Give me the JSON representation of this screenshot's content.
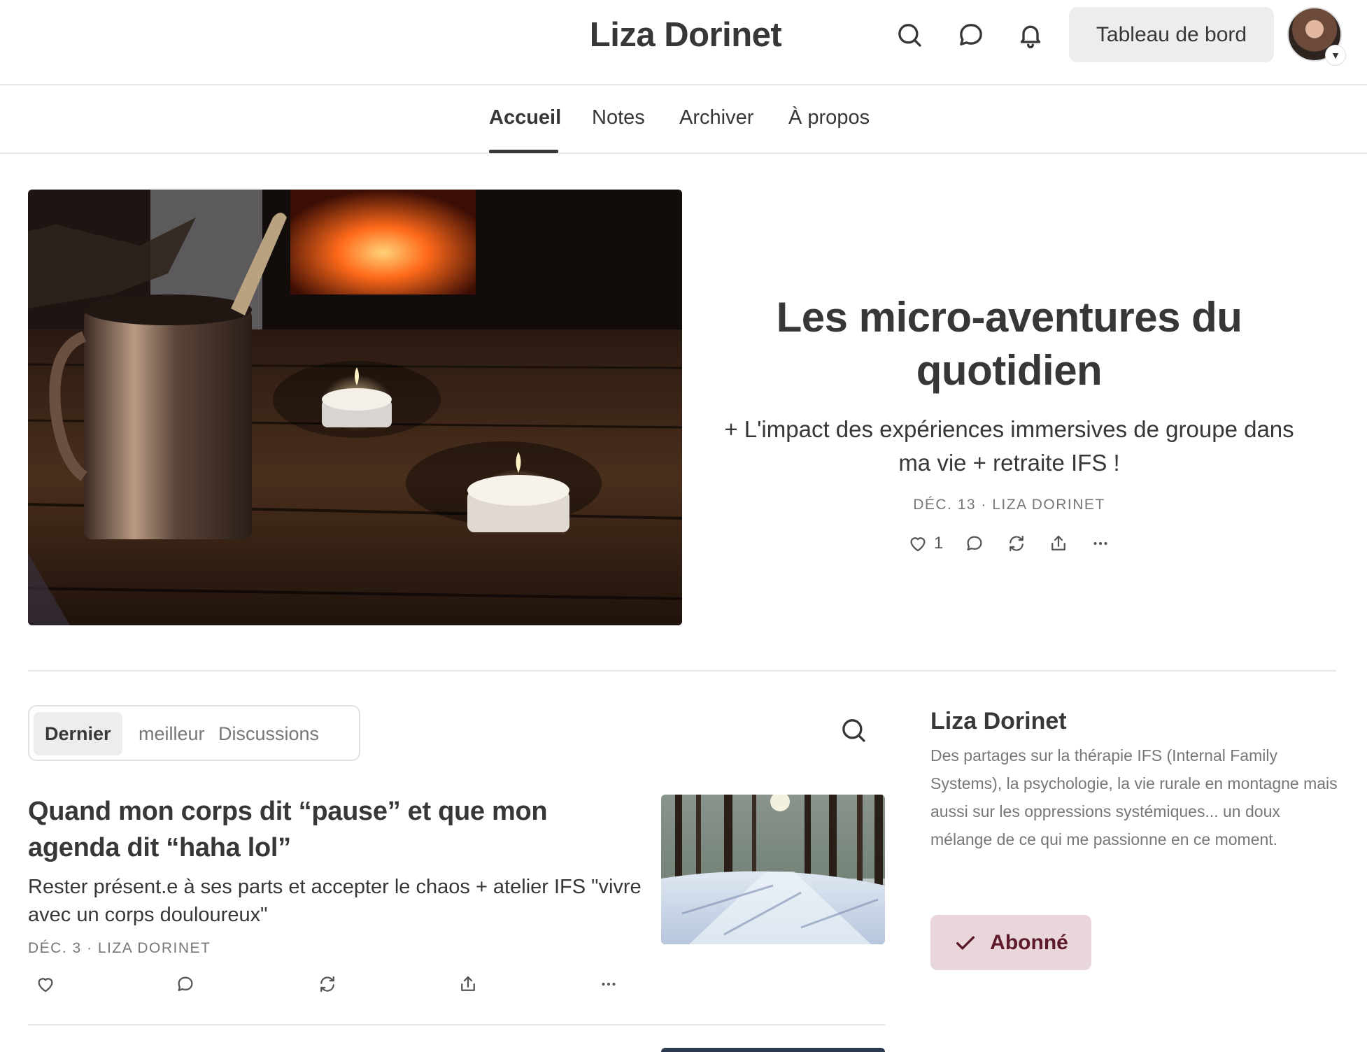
{
  "header": {
    "title": "Liza Dorinet",
    "icons": [
      "search-icon",
      "chat-icon",
      "bell-icon"
    ],
    "dashboard_label": "Tableau de bord"
  },
  "nav": {
    "tabs": [
      {
        "label": "Accueil",
        "active": true
      },
      {
        "label": "Notes",
        "active": false
      },
      {
        "label": "Archiver",
        "active": false
      },
      {
        "label": "À propos",
        "active": false
      }
    ]
  },
  "featured": {
    "title": "Les micro-aventures du quotidien",
    "subtitle": "+ L'impact des expériences immersives de groupe dans ma vie + retraite IFS !",
    "meta": "DÉC. 13 · LIZA DORINET",
    "likes": "1"
  },
  "feed": {
    "tabs": [
      {
        "label": "Dernier",
        "active": true
      },
      {
        "label": "meilleur",
        "active": false
      },
      {
        "label": "Discussions",
        "active": false
      }
    ],
    "posts": [
      {
        "title": "Quand mon corps dit “pause” et que mon agenda dit “haha lol”",
        "subtitle": "Rester présent.e à ses parts et accepter le chaos + atelier IFS \"vivre avec un corps douloureux\"",
        "meta": "DÉC. 3 · LIZA DORINET"
      }
    ]
  },
  "sidebar": {
    "name": "Liza Dorinet",
    "description": "Des partages sur la thérapie IFS (Internal Family Systems), la psychologie, la vie rurale en montagne mais aussi sur les oppressions systémiques... un doux mélange de ce qui me passionne en ce moment.",
    "subscribe_label": "Abonné"
  },
  "colors": {
    "text": "#363737",
    "muted": "#777777",
    "button_bg": "#ededed",
    "subscribed_bg": "#e8d6da",
    "subscribed_text": "#5e1a2c"
  }
}
